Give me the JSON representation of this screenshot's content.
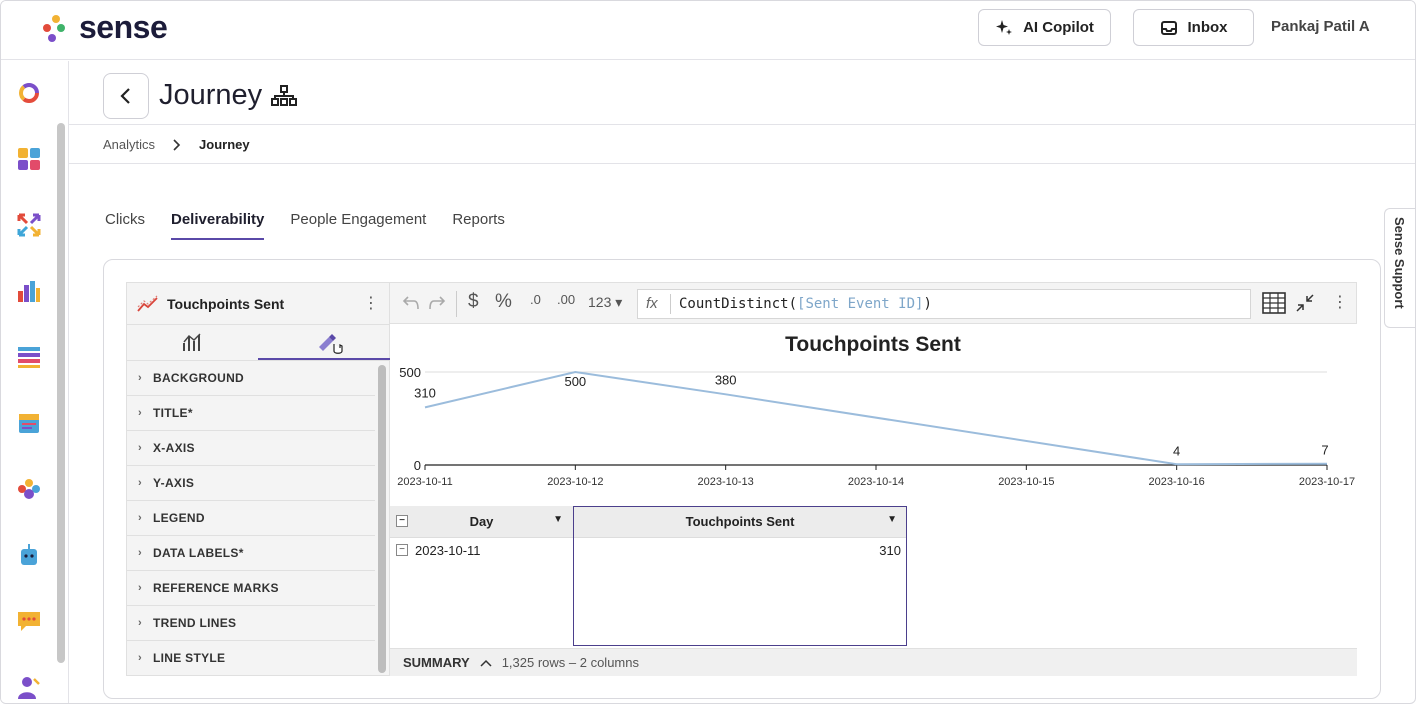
{
  "app": {
    "logo_text": "sense",
    "ai_copilot_label": "AI Copilot",
    "inbox_label": "Inbox",
    "user_name": "Pankaj Patil A"
  },
  "page": {
    "title": "Journey",
    "breadcrumb": [
      "Analytics",
      "Journey"
    ]
  },
  "tabs": [
    {
      "label": "Clicks",
      "active": false
    },
    {
      "label": "Deliverability",
      "active": true
    },
    {
      "label": "People Engagement",
      "active": false
    },
    {
      "label": "Reports",
      "active": false
    }
  ],
  "support_label": "Sense Support",
  "panel": {
    "title": "Touchpoints Sent",
    "sections": [
      "BACKGROUND",
      "TITLE*",
      "X-AXIS",
      "Y-AXIS",
      "LEGEND",
      "DATA LABELS*",
      "REFERENCE MARKS",
      "TREND LINES",
      "LINE STYLE"
    ]
  },
  "toolbar": {
    "currency_symbol": "$",
    "percent_symbol": "%",
    "dec_less": ".0",
    "dec_more": ".00",
    "number_format": "123",
    "formula_fn": "CountDistinct(",
    "formula_ref": "[Sent Event ID]",
    "formula_close": ")"
  },
  "chart_data": {
    "type": "line",
    "title": "Touchpoints Sent",
    "x": [
      "2023-10-11",
      "2023-10-12",
      "2023-10-13",
      "2023-10-14",
      "2023-10-15",
      "2023-10-16",
      "2023-10-17"
    ],
    "points": [
      {
        "x": "2023-10-11",
        "y": 310,
        "label": "310"
      },
      {
        "x": "2023-10-12",
        "y": 500,
        "label": "500"
      },
      {
        "x": "2023-10-13",
        "y": 380,
        "label": "380"
      },
      {
        "x": "2023-10-16",
        "y": 4,
        "label": "4"
      },
      {
        "x": "2023-10-17",
        "y": 7,
        "label": "7"
      }
    ],
    "y_ticks": [
      "0",
      "500"
    ],
    "ylim": [
      0,
      500
    ],
    "line_color": "#9bbcdc",
    "grid": true
  },
  "table": {
    "columns": [
      "Day",
      "Touchpoints Sent"
    ],
    "rows": [
      [
        "2023-10-11",
        "310"
      ]
    ]
  },
  "summary": {
    "label": "SUMMARY",
    "text": "1,325 rows – 2 columns"
  },
  "colors": {
    "accent": "#5a49a8",
    "line": "#9bbcdc"
  }
}
